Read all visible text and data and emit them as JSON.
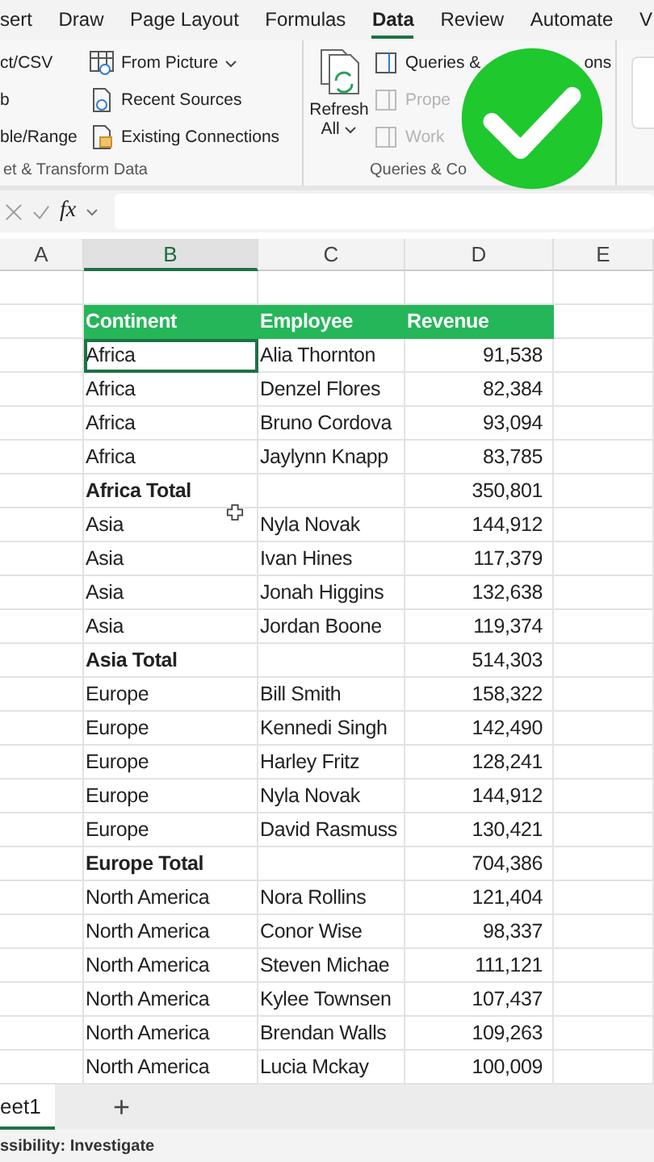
{
  "ribbon_tabs": [
    {
      "label": "sert",
      "selected": false
    },
    {
      "label": "Draw",
      "selected": false
    },
    {
      "label": "Page Layout",
      "selected": false
    },
    {
      "label": "Formulas",
      "selected": false
    },
    {
      "label": "Data",
      "selected": true
    },
    {
      "label": "Review",
      "selected": false
    },
    {
      "label": "Automate",
      "selected": false
    },
    {
      "label": "V",
      "selected": false
    }
  ],
  "get_group": {
    "label": "et & Transform Data",
    "left_items": [
      "ct/CSV",
      "b",
      "ble/Range"
    ],
    "items": [
      {
        "label": "From Picture",
        "kind": "dropdown"
      },
      {
        "label": "Recent Sources",
        "kind": "recent"
      },
      {
        "label": "Existing Connections",
        "kind": "connections"
      }
    ]
  },
  "queries_group": {
    "label": "Queries & Co",
    "refresh": {
      "line1": "Refresh",
      "line2": "All"
    },
    "items": [
      {
        "label": "Queries &",
        "tail": "ons",
        "disabled": false
      },
      {
        "label": "Prope",
        "disabled": true
      },
      {
        "label": "Work",
        "disabled": true
      }
    ]
  },
  "formula_bar": {
    "fx": "fx"
  },
  "columns": [
    {
      "label": "A",
      "selected": false
    },
    {
      "label": "B",
      "selected": true
    },
    {
      "label": "C",
      "selected": false
    },
    {
      "label": "D",
      "selected": false
    },
    {
      "label": "E",
      "selected": false
    }
  ],
  "table": {
    "headers": [
      "Continent",
      "Employee",
      "Revenue"
    ],
    "rows": [
      {
        "kind": "data",
        "continent": "Africa",
        "employee": "Alia Thornton",
        "revenue": "91,538",
        "selected": true
      },
      {
        "kind": "data",
        "continent": "Africa",
        "employee": "Denzel Flores",
        "revenue": "82,384",
        "selected": false
      },
      {
        "kind": "data",
        "continent": "Africa",
        "employee": "Bruno Cordova",
        "revenue": "93,094",
        "selected": false
      },
      {
        "kind": "data",
        "continent": "Africa",
        "employee": "Jaylynn Knapp",
        "revenue": "83,785",
        "selected": false
      },
      {
        "kind": "total",
        "continent": "Africa Total",
        "revenue": "350,801",
        "selected": false
      },
      {
        "kind": "data",
        "continent": "Asia",
        "employee": "Nyla Novak",
        "revenue": "144,912",
        "selected": false
      },
      {
        "kind": "data",
        "continent": "Asia",
        "employee": "Ivan Hines",
        "revenue": "117,379",
        "selected": false
      },
      {
        "kind": "data",
        "continent": "Asia",
        "employee": "Jonah Higgins",
        "revenue": "132,638",
        "selected": false
      },
      {
        "kind": "data",
        "continent": "Asia",
        "employee": "Jordan Boone",
        "revenue": "119,374",
        "selected": false
      },
      {
        "kind": "total",
        "continent": "Asia Total",
        "revenue": "514,303",
        "selected": false
      },
      {
        "kind": "data",
        "continent": "Europe",
        "employee": "Bill Smith",
        "revenue": "158,322",
        "selected": false
      },
      {
        "kind": "data",
        "continent": "Europe",
        "employee": "Kennedi Singh",
        "revenue": "142,490",
        "selected": false
      },
      {
        "kind": "data",
        "continent": "Europe",
        "employee": "Harley Fritz",
        "revenue": "128,241",
        "selected": false
      },
      {
        "kind": "data",
        "continent": "Europe",
        "employee": "Nyla Novak",
        "revenue": "144,912",
        "selected": false
      },
      {
        "kind": "data",
        "continent": "Europe",
        "employee": "David Rasmuss",
        "revenue": "130,421",
        "selected": false
      },
      {
        "kind": "total",
        "continent": "Europe Total",
        "revenue": "704,386",
        "selected": false
      },
      {
        "kind": "data",
        "continent": "North America",
        "employee": "Nora Rollins",
        "revenue": "121,404",
        "selected": false
      },
      {
        "kind": "data",
        "continent": "North America",
        "employee": "Conor Wise",
        "revenue": "98,337",
        "selected": false
      },
      {
        "kind": "data",
        "continent": "North America",
        "employee": "Steven Michae",
        "revenue": "111,121",
        "selected": false
      },
      {
        "kind": "data",
        "continent": "North America",
        "employee": "Kylee Townsen",
        "revenue": "107,437",
        "selected": false
      },
      {
        "kind": "data",
        "continent": "North America",
        "employee": "Brendan Walls",
        "revenue": "109,263",
        "selected": false
      },
      {
        "kind": "data",
        "continent": "North America",
        "employee": "Lucia Mckay",
        "revenue": "100,009",
        "selected": false
      }
    ]
  },
  "sheet_tabs": [
    {
      "label": "eet1",
      "selected": true
    }
  ],
  "add_sheet": "+",
  "status_bar": "ssibility: Investigate"
}
